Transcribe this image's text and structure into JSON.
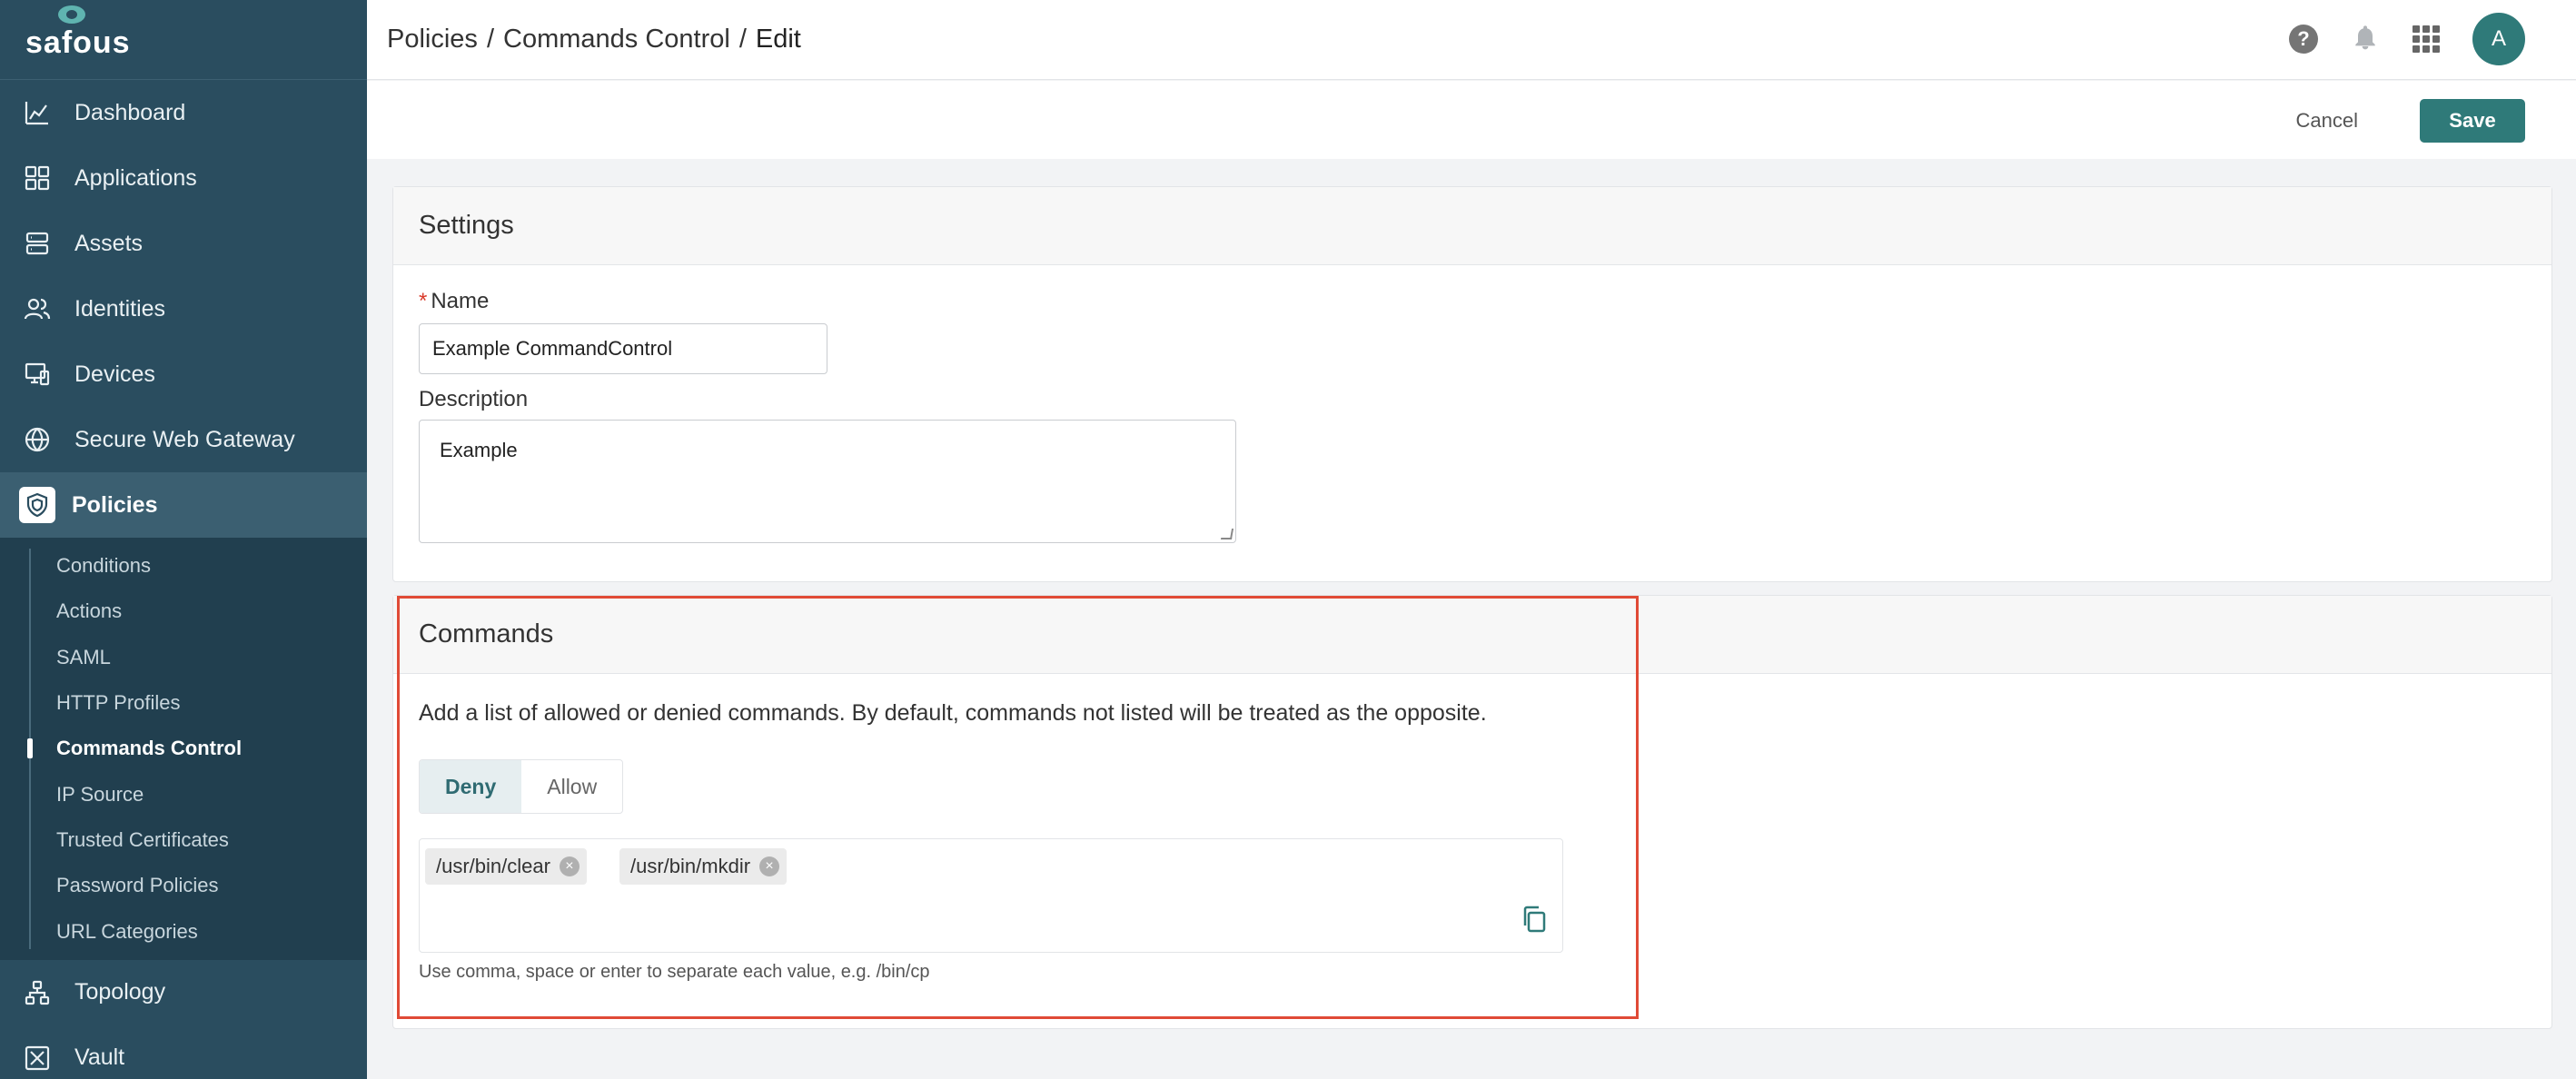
{
  "brand": {
    "name": "safous"
  },
  "sidebar": {
    "items": [
      {
        "label": "Dashboard",
        "icon": "chart-icon"
      },
      {
        "label": "Applications",
        "icon": "apps-grid-icon"
      },
      {
        "label": "Assets",
        "icon": "server-icon"
      },
      {
        "label": "Identities",
        "icon": "users-icon"
      },
      {
        "label": "Devices",
        "icon": "devices-icon"
      },
      {
        "label": "Secure Web Gateway",
        "icon": "globe-icon"
      },
      {
        "label": "Policies",
        "icon": "shield-icon",
        "active": true
      },
      {
        "label": "Topology",
        "icon": "topology-icon"
      },
      {
        "label": "Vault",
        "icon": "vault-icon"
      }
    ],
    "policies_sub": [
      {
        "label": "Conditions"
      },
      {
        "label": "Actions"
      },
      {
        "label": "SAML"
      },
      {
        "label": "HTTP Profiles"
      },
      {
        "label": "Commands Control",
        "active": true
      },
      {
        "label": "IP Source"
      },
      {
        "label": "Trusted Certificates"
      },
      {
        "label": "Password Policies"
      },
      {
        "label": "URL Categories"
      }
    ]
  },
  "header": {
    "breadcrumb": [
      "Policies",
      "/",
      "Commands Control",
      "/",
      "Edit"
    ],
    "help_label": "?",
    "avatar_initial": "A"
  },
  "actions": {
    "cancel": "Cancel",
    "save": "Save"
  },
  "settings": {
    "title": "Settings",
    "required_mark": "*",
    "name_label": "Name",
    "name_value": "Example CommandControl",
    "description_label": "Description",
    "description_value": "Example"
  },
  "commands": {
    "title": "Commands",
    "description": "Add a list of allowed or denied commands. By default, commands not listed will be treated as the opposite.",
    "modes": [
      "Deny",
      "Allow"
    ],
    "selected_mode": "Deny",
    "tags": [
      "/usr/bin/clear",
      "/usr/bin/mkdir"
    ],
    "hint": "Use comma, space or enter to separate each value, e.g. /bin/cp"
  },
  "colors": {
    "sidebar": "#2a4d5f",
    "accent": "#2f7a79",
    "highlight": "#e04a36"
  }
}
